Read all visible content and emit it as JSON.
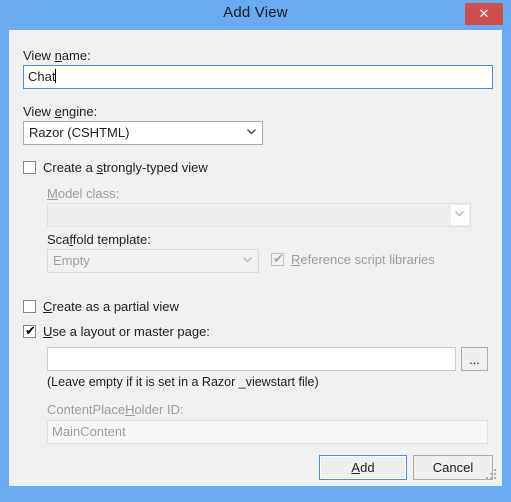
{
  "window": {
    "title": "Add View",
    "close_label": "✕",
    "close_icon": "close-icon",
    "accent_blue": "#6aaaf0",
    "close_red": "#cf4f4f",
    "client_bg": "#f0f0f0"
  },
  "form": {
    "view_name": {
      "label_pre": "View ",
      "label_accel": "n",
      "label_post": "ame:",
      "label_full": "View name:",
      "value": "Chat",
      "placeholder": ""
    },
    "view_engine": {
      "label_pre": "View ",
      "label_accel": "e",
      "label_post": "ngine:",
      "label_full": "View engine:",
      "value": "Razor (CSHTML)",
      "options": [
        "Razor (CSHTML)"
      ]
    },
    "strongly_typed": {
      "label_pre": "Create a ",
      "label_accel": "s",
      "label_post": "trongly-typed view",
      "label_full": "Create a strongly-typed view",
      "checked": false,
      "enabled": true
    },
    "model_class": {
      "label_accel": "M",
      "label_post": "odel class:",
      "label_full": "Model class:",
      "value": "",
      "enabled": false
    },
    "scaffold_template": {
      "label_pre": "Sca",
      "label_accel": "f",
      "label_post": "fold template:",
      "label_full": "Scaffold template:",
      "value": "Empty",
      "enabled": false,
      "options": [
        "Empty"
      ]
    },
    "reference_script_libraries": {
      "label_pre": "",
      "label_accel": "R",
      "label_post": "eference script libraries",
      "label_full": "Reference script libraries",
      "checked": true,
      "enabled": false
    },
    "partial_view": {
      "label_pre": "",
      "label_accel": "C",
      "label_post": "reate as a partial view",
      "label_full": "Create as a partial view",
      "checked": false,
      "enabled": true
    },
    "use_layout": {
      "label_pre": "",
      "label_accel": "U",
      "label_post": "se a layout or master page:",
      "label_full": "Use a layout or master page:",
      "checked": true,
      "enabled": true
    },
    "layout_path": {
      "value": "",
      "placeholder": "",
      "browse_label": "..."
    },
    "layout_hint": "(Leave empty if it is set in a Razor _viewstart file)",
    "content_placeholder": {
      "label_pre": "ContentPlace",
      "label_accel": "H",
      "label_post": "older ID:",
      "label_full": "ContentPlaceHolder ID:",
      "value": "MainContent",
      "enabled": false
    }
  },
  "footer": {
    "add": {
      "label_accel": "A",
      "label_post": "dd",
      "label_full": "Add",
      "is_default": true
    },
    "cancel": {
      "label_full": "Cancel",
      "is_default": false
    }
  }
}
